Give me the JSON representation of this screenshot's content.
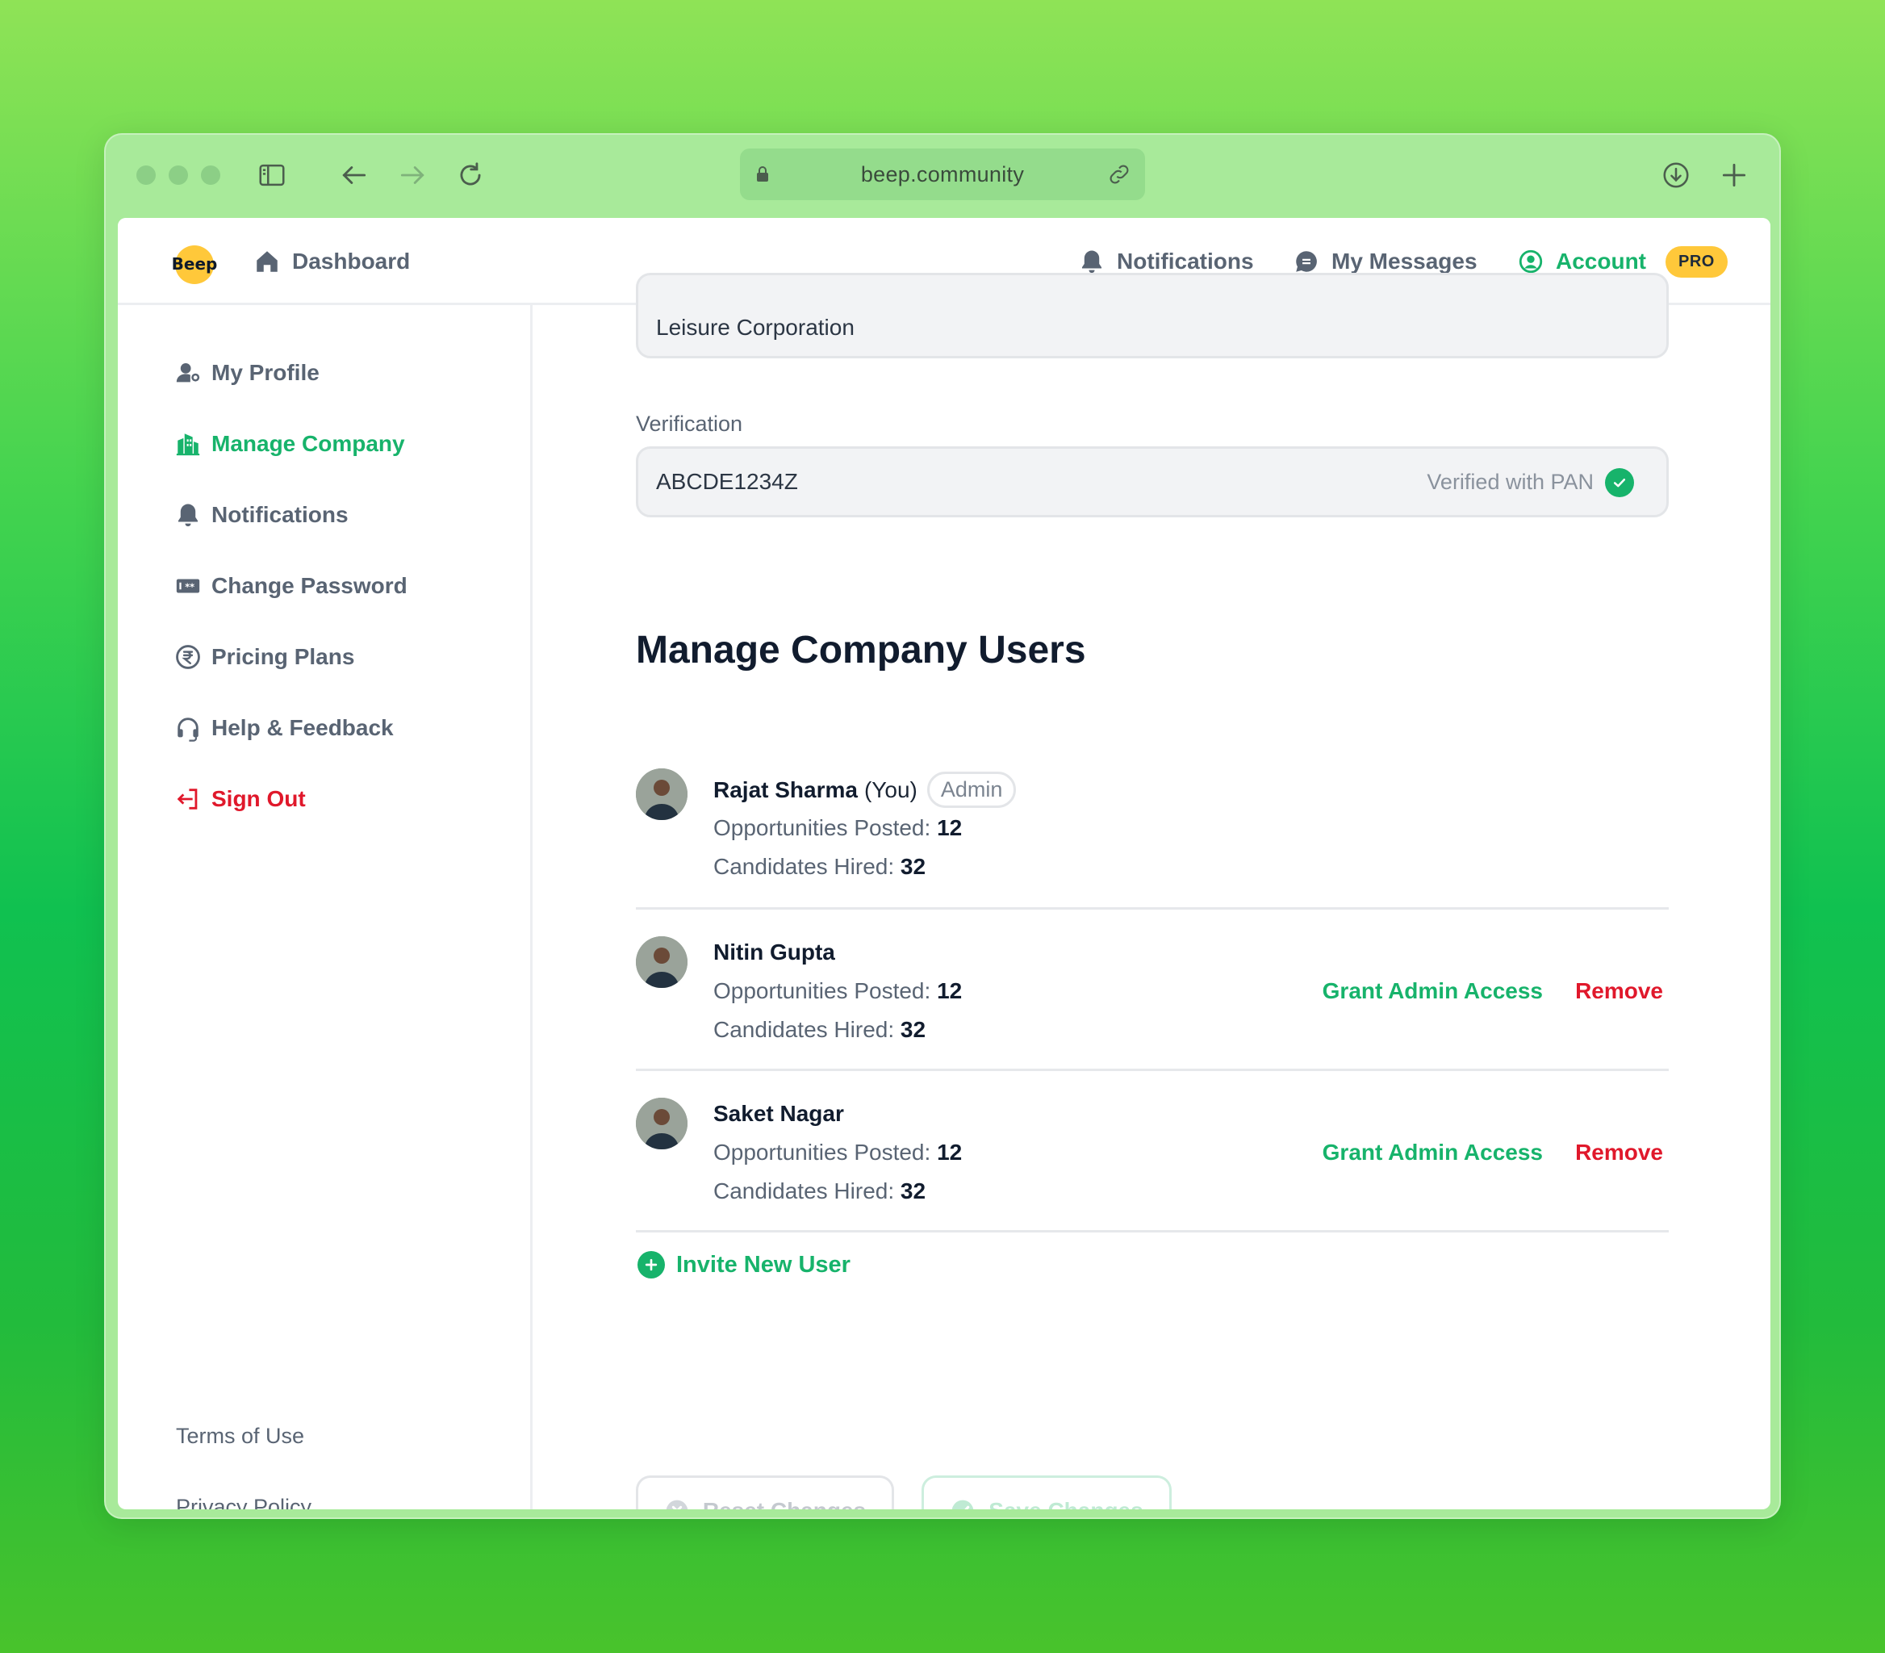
{
  "browser": {
    "url": "beep.community"
  },
  "topnav": {
    "logo_text": "Beep",
    "dashboard": "Dashboard",
    "notifications": "Notifications",
    "messages": "My Messages",
    "account": "Account",
    "pro": "PRO"
  },
  "sidebar": {
    "items": [
      {
        "label": "My Profile",
        "icon": "user-gear-icon"
      },
      {
        "label": "Manage Company",
        "icon": "building-icon",
        "active": true
      },
      {
        "label": "Notifications",
        "icon": "bell-icon"
      },
      {
        "label": "Change Password",
        "icon": "password-icon"
      },
      {
        "label": "Pricing Plans",
        "icon": "rupee-icon"
      },
      {
        "label": "Help & Feedback",
        "icon": "headset-icon"
      },
      {
        "label": "Sign Out",
        "icon": "sign-out-icon"
      }
    ],
    "footer": {
      "terms": "Terms of Use",
      "privacy": "Privacy Policy"
    }
  },
  "company": {
    "name_value": "Leisure Corporation",
    "verification_label": "Verification",
    "verification_value": "ABCDE1234Z",
    "verified_text": "Verified with PAN"
  },
  "users": {
    "title": "Manage Company Users",
    "stats_labels": {
      "posted": "Opportunities Posted:",
      "hired": "Candidates Hired:"
    },
    "list": [
      {
        "name": "Rajat Sharma",
        "you": "(You)",
        "badge": "Admin",
        "posted": "12",
        "hired": "32"
      },
      {
        "name": "Nitin Gupta",
        "posted": "12",
        "hired": "32",
        "grant": "Grant Admin Access",
        "remove": "Remove"
      },
      {
        "name": "Saket Nagar",
        "posted": "12",
        "hired": "32",
        "grant": "Grant Admin Access",
        "remove": "Remove"
      }
    ],
    "invite": "Invite New User"
  },
  "actions": {
    "reset": "Reset Changes",
    "save": "Save Changes"
  },
  "colors": {
    "accent": "#17b36b",
    "danger": "#e0182b",
    "pro": "#ffc83a"
  }
}
